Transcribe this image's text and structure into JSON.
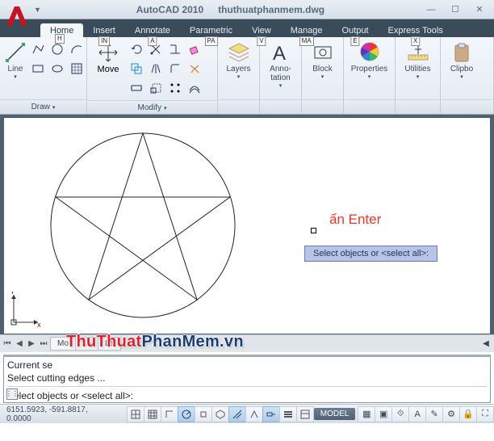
{
  "title": {
    "app": "AutoCAD 2010",
    "file": "thuthuatphanmem.dwg"
  },
  "tabs": [
    {
      "label": "Home",
      "key": "H",
      "active": true
    },
    {
      "label": "Insert",
      "key": "IN"
    },
    {
      "label": "Annotate",
      "key": "A"
    },
    {
      "label": "Parametric",
      "key": "PA"
    },
    {
      "label": "View",
      "key": "V"
    },
    {
      "label": "Manage",
      "key": "MA"
    },
    {
      "label": "Output",
      "key": "E"
    },
    {
      "label": "Express Tools",
      "key": "X"
    }
  ],
  "panels": {
    "draw": {
      "label": "Draw",
      "big": "Line"
    },
    "modify": {
      "label": "Modify",
      "big": "Move"
    },
    "layers": {
      "label": "Layers"
    },
    "anno": {
      "label": "Anno-\ntation"
    },
    "block": {
      "label": "Block"
    },
    "props": {
      "label": "Properties"
    },
    "util": {
      "label": "Utilities"
    },
    "clip": {
      "label": "Clipbo"
    }
  },
  "overlay": {
    "enter": "ấn Enter",
    "prompt": "Select objects or <select all>:"
  },
  "model_tabs": [
    "Mo",
    "La",
    "La"
  ],
  "cmd": {
    "line1": "Current se",
    "line2": "Select cutting edges ...",
    "line3": "Select objects or <select all>:"
  },
  "status": {
    "coords": "6151.5923, -591.8817, 0.0000",
    "mode": "MODEL"
  },
  "watermark": {
    "part1": "ThuThuat",
    "part2": "PhanMem.vn"
  }
}
